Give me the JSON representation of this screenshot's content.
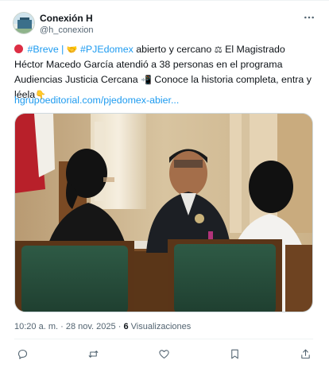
{
  "author": {
    "name": "Conexión H",
    "handle": "@h_conexion"
  },
  "tweet": {
    "tag_breve": "#Breve",
    "separator": "|",
    "tag_pjedomex": "#PJEdomex",
    "text_1": " abierto y cercano ",
    "text_2": " El Magistrado Héctor Macedo García atendió a 38 personas en el programa Audiencias Justicia Cercana ",
    "text_3": " Conoce la historia completa, entra y léela",
    "emoji_handshake": "🤝",
    "emoji_scales": "⚖",
    "emoji_phone": "📲",
    "emoji_point": "👇",
    "link": "hgrupoeditorial.com/pjedomex-abier..."
  },
  "meta": {
    "time": "10:20 a. m.",
    "dot": "·",
    "date": "28 nov. 2025",
    "views_count": "6",
    "views_label": "Visualizaciones"
  },
  "icons": [
    "more-icon",
    "reply-icon",
    "retweet-icon",
    "like-icon",
    "bookmark-icon",
    "share-icon"
  ],
  "colors": {
    "link": "#1d9bf0",
    "text": "#0f1419",
    "muted": "#536471"
  }
}
